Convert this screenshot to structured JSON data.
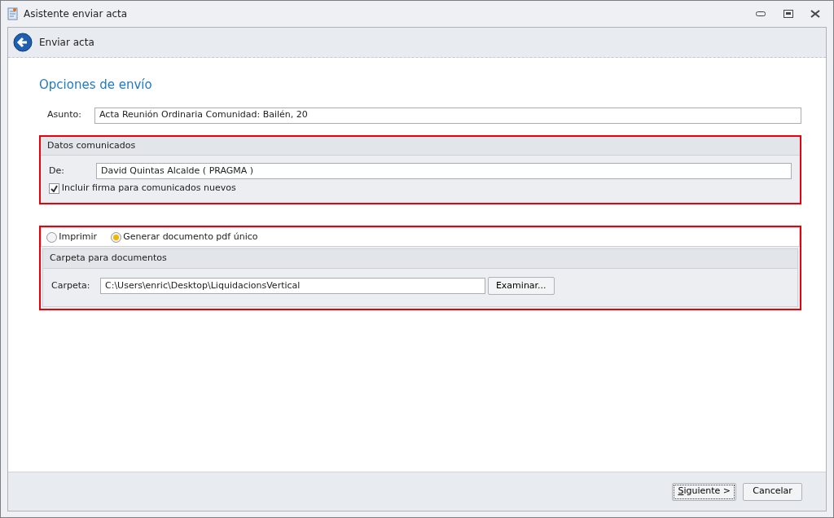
{
  "window": {
    "title": "Asistente enviar acta"
  },
  "header": {
    "title": "Enviar acta"
  },
  "section_title": "Opciones de envío",
  "subject": {
    "label": "Asunto:",
    "value": "Acta Reunión  Ordinaria Comunidad: Bailén, 20"
  },
  "sender_group": {
    "title": "Datos comunicados",
    "highlighted": true,
    "from_label": "De:",
    "from_value": "David Quintas Alcalde ( PRAGMA )",
    "signature": {
      "label": "Incluir firma para comunicados nuevos",
      "checked": true
    }
  },
  "output_group": {
    "highlighted": true,
    "options": [
      {
        "label": "Imprimir",
        "selected": false
      },
      {
        "label": "Generar documento pdf único",
        "selected": true
      }
    ],
    "folder_group": {
      "title": "Carpeta para documentos",
      "label": "Carpeta:",
      "value": "C:\\Users\\enric\\Desktop\\LiquidacionsVertical",
      "browse_button": "Examinar..."
    }
  },
  "buttons": [
    {
      "label": "Siguiente >",
      "focused": true
    },
    {
      "label": "Cancelar",
      "focused": false
    }
  ]
}
